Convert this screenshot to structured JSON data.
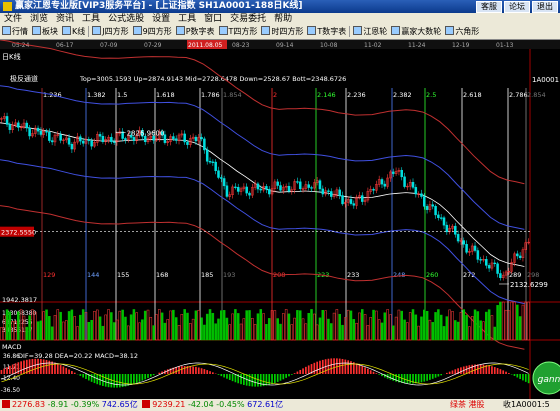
{
  "titlebar": {
    "title": "赢家江恩专业版[VIP3服务平台] - [上证指数  SH1A0001-188日K线]",
    "buttons": [
      "客服",
      "论坛",
      "退出"
    ]
  },
  "menubar": [
    "文件",
    "浏览",
    "资讯",
    "工具",
    "公式选股",
    "设置",
    "工具",
    "窗口",
    "交易委托",
    "帮助"
  ],
  "toolbar": [
    {
      "label": "行情",
      "icon": "grid-icon"
    },
    {
      "label": "板块",
      "icon": "sector-icon"
    },
    {
      "label": "K线",
      "icon": "candlestick-icon"
    },
    {
      "label": "J四方形",
      "icon": "square-icon"
    },
    {
      "label": "9四方形",
      "icon": "square-icon"
    },
    {
      "label": "P数字表",
      "icon": "table-icon"
    },
    {
      "label": "T四方形",
      "icon": "square-icon"
    },
    {
      "label": "时四方形",
      "icon": "square-icon"
    },
    {
      "label": "T数字表",
      "icon": "table-icon"
    },
    {
      "label": "江恩轮",
      "icon": "wheel-icon"
    },
    {
      "label": "赢家大数轮",
      "icon": "wheel-icon"
    },
    {
      "label": "六角形",
      "icon": "hexagon-icon"
    }
  ],
  "chart_header": {
    "period": "日K线",
    "indicator_name": "极反通道",
    "values_text": "Top=3005.1593 Up=2874.9143 Mid=2728.6478 Down=2528.67 Bott=2348.6726",
    "symbol": "1A0001",
    "price_axis_value": "2372.5550"
  },
  "date_labels": [
    "05-24",
    "06-17",
    "07-09",
    "07-29",
    "2011.08.05",
    "08-23",
    "09-14",
    "10-08",
    "11-02",
    "11-24",
    "12-19",
    "01-13"
  ],
  "selected_date": "2011.08.05",
  "fib_ratios": [
    {
      "label": "1.236",
      "color": "#ffffff"
    },
    {
      "label": "1.382",
      "color": "#ffffff"
    },
    {
      "label": "1.5",
      "color": "#ffffff"
    },
    {
      "label": "1.618",
      "color": "#ffffff"
    },
    {
      "label": "1.786",
      "color": "#ffffff"
    },
    {
      "label": "1.854",
      "color": "#777777"
    },
    {
      "label": "2",
      "color": "#ff3030"
    },
    {
      "label": "2.146",
      "color": "#30ff30"
    },
    {
      "label": "2.236",
      "color": "#ffffff"
    },
    {
      "label": "2.382",
      "color": "#ffffff"
    },
    {
      "label": "2.5",
      "color": "#30ff30"
    },
    {
      "label": "2.618",
      "color": "#ffffff"
    },
    {
      "label": "2.786",
      "color": "#ffffff"
    },
    {
      "label": "2.854",
      "color": "#777777"
    }
  ],
  "day_counts": [
    {
      "label": "129",
      "color": "#ff3030"
    },
    {
      "label": "144",
      "color": "#6fa0ff"
    },
    {
      "label": "155",
      "color": "#ffffff"
    },
    {
      "label": "168",
      "color": "#ffffff"
    },
    {
      "label": "185",
      "color": "#ffffff"
    },
    {
      "label": "193",
      "color": "#777777"
    },
    {
      "label": "208",
      "color": "#ff3030"
    },
    {
      "label": "223",
      "color": "#30ff30"
    },
    {
      "label": "233",
      "color": "#ffffff"
    },
    {
      "label": "248",
      "color": "#6fa0ff"
    },
    {
      "label": "260",
      "color": "#30ff30"
    },
    {
      "label": "272",
      "color": "#ffffff"
    },
    {
      "label": "289",
      "color": "#ffffff"
    },
    {
      "label": "298",
      "color": "#777777"
    }
  ],
  "annotations": {
    "high_label": "2826.9600",
    "low_label": "2132.6299"
  },
  "volume_panel": {
    "top_label": "1942.3817",
    "ticks": [
      "103068380",
      "68712255",
      "34356127"
    ]
  },
  "macd_panel": {
    "title": "MACD",
    "values_text": "DIF=39.28  DEA=20.22  MACD=38.12",
    "ticks": [
      "36.86",
      "11.71",
      "-12.40",
      "-36.50"
    ]
  },
  "watermark": "gann",
  "statusbar": {
    "sh_value": "2276.83",
    "sh_change": "-8.91",
    "sh_pct": "-0.39%",
    "sh_amount": "742.65亿",
    "sz_value": "9239.21",
    "sz_change": "-42.04",
    "sz_pct": "-0.45%",
    "sz_amount": "672.61亿",
    "right_text": "绿茶 港股",
    "quote_text": "收1A0001:5"
  },
  "colors": {
    "candle_up": "#ff3a3a",
    "candle_down": "#00e0e0",
    "band_outer": "#c03030",
    "band_inner": "#4050e0",
    "mid_line": "#ffffff",
    "volume_up": "#ff3a3a",
    "volume_down": "#00c000"
  },
  "chart_data": {
    "type": "candlestick",
    "bars": 188,
    "price_labels": [
      "2826.9600",
      "2132.6299",
      "2372.5550"
    ],
    "macd": {
      "DIF": 39.28,
      "DEA": 20.22,
      "MACD": 38.12
    }
  }
}
